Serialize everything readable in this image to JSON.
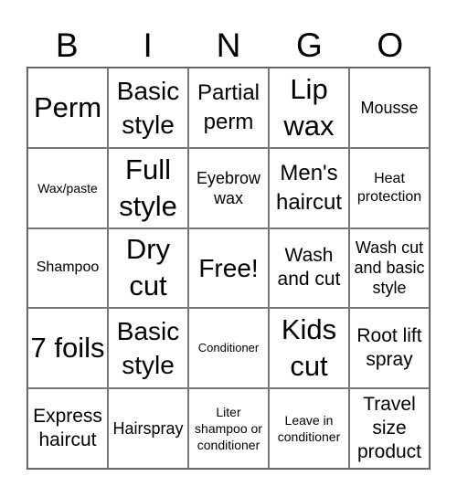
{
  "header": [
    "B",
    "I",
    "N",
    "G",
    "O"
  ],
  "cells": [
    [
      "Perm",
      "Basic style",
      "Partial perm",
      "Lip wax",
      "Mousse"
    ],
    [
      "Wax/paste",
      "Full style",
      "Eyebrow wax",
      "Men's haircut",
      "Heat protection"
    ],
    [
      "Shampoo",
      "Dry cut",
      "Free!",
      "Wash and cut",
      "Wash cut and basic style"
    ],
    [
      "7 foils",
      "Basic style",
      "Conditioner",
      "Kids cut",
      "Root lift spray"
    ],
    [
      "Express haircut",
      "Hairspray",
      "Liter shampoo or conditioner",
      "Leave in conditioner",
      "Travel size product"
    ]
  ]
}
